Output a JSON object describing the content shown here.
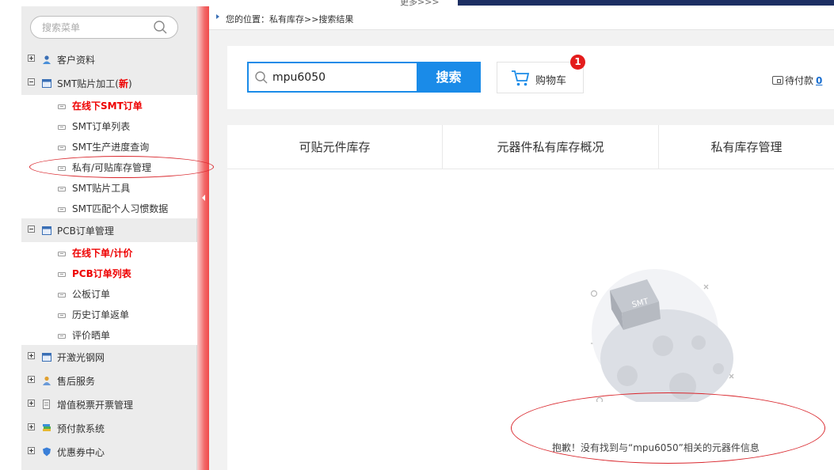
{
  "top": {
    "more_label": "更多>>>"
  },
  "sidebar": {
    "search_placeholder": "搜索菜单",
    "groups": [
      {
        "label": "客户资料"
      },
      {
        "label": "SMT贴片加工(",
        "new_label": "新",
        "suffix": ")",
        "items": [
          {
            "label": "在线下SMT订单"
          },
          {
            "label": "SMT订单列表"
          },
          {
            "label": "SMT生产进度查询"
          },
          {
            "label": "私有/可贴库存管理"
          },
          {
            "label": "SMT贴片工具"
          },
          {
            "label": "SMT匹配个人习惯数据"
          }
        ]
      },
      {
        "label": "PCB订单管理",
        "items": [
          {
            "label": "在线下单/计价"
          },
          {
            "label": "PCB订单列表"
          },
          {
            "label": "公板订单"
          },
          {
            "label": "历史订单返单"
          },
          {
            "label": "评价晒单"
          }
        ]
      },
      {
        "label": "开激光钢网"
      },
      {
        "label": "售后服务"
      },
      {
        "label": "增值税票开票管理"
      },
      {
        "label": "预付款系统"
      },
      {
        "label": "优惠券中心"
      }
    ]
  },
  "breadcrumb": {
    "text": "您的位置：私有库存>>搜索结果"
  },
  "search": {
    "value": "mpu6050",
    "button_label": "搜索"
  },
  "cart": {
    "label": "购物车",
    "badge": "1"
  },
  "pending": {
    "label": "待付款",
    "count": "0"
  },
  "tabs": [
    {
      "label": "可贴元件库存"
    },
    {
      "label": "元器件私有库存概况"
    },
    {
      "label": "私有库存管理"
    }
  ],
  "empty": {
    "box_text": "SMT",
    "message": "抱歉！没有找到与“mpu6050”相关的元器件信息"
  },
  "colors": {
    "accent": "#1a8be8",
    "alert": "#e41c1c",
    "annotation": "#d9262c"
  }
}
